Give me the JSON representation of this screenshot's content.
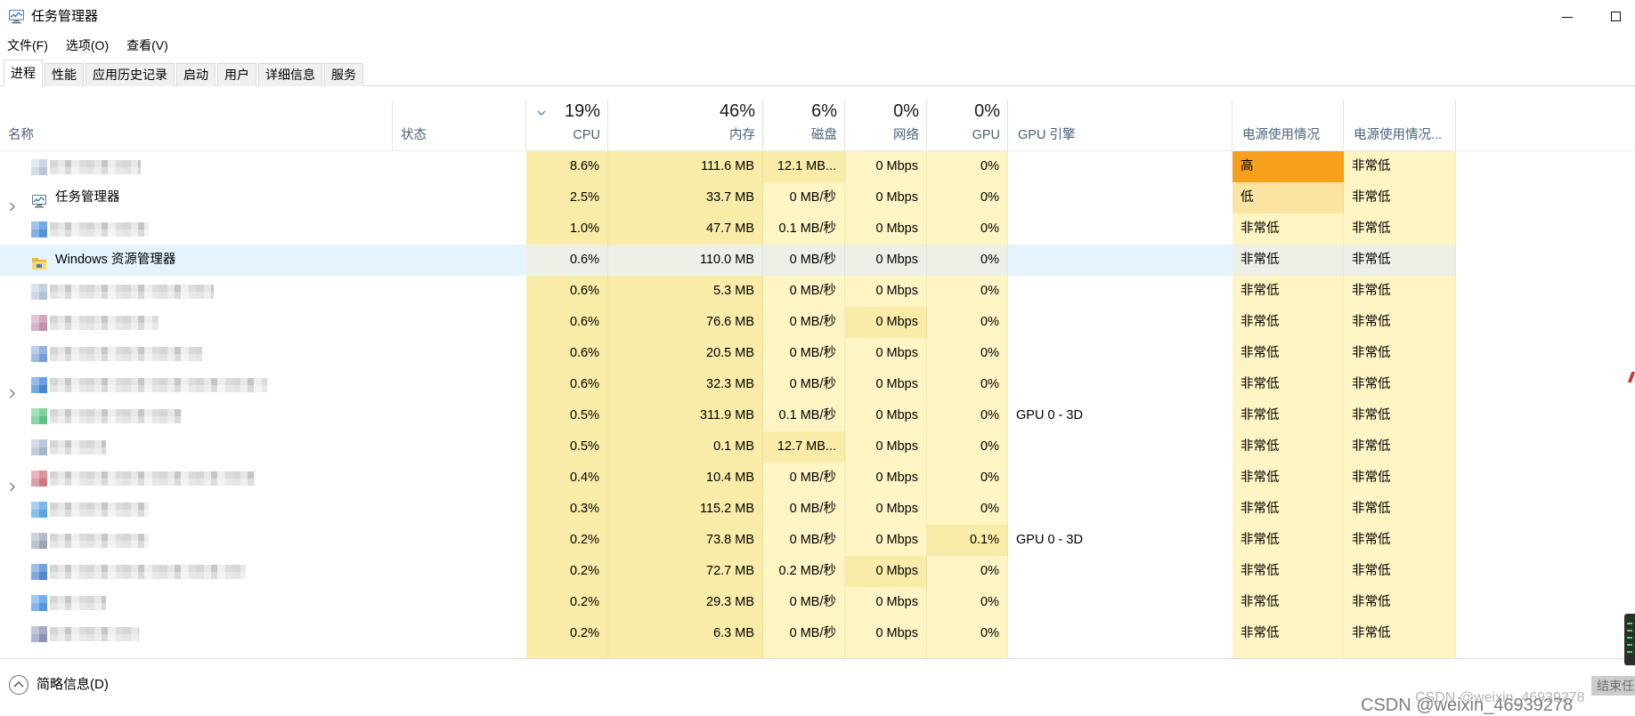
{
  "window": {
    "title": "任务管理器",
    "icon": "task-manager-icon",
    "controls": [
      "minimize-icon",
      "maximize-icon"
    ]
  },
  "menu": [
    {
      "label": "文件(F)"
    },
    {
      "label": "选项(O)"
    },
    {
      "label": "查看(V)"
    }
  ],
  "tabs": [
    {
      "label": "进程",
      "selected": true
    },
    {
      "label": "性能",
      "selected": false
    },
    {
      "label": "应用历史记录",
      "selected": false
    },
    {
      "label": "启动",
      "selected": false
    },
    {
      "label": "用户",
      "selected": false
    },
    {
      "label": "详细信息",
      "selected": false
    },
    {
      "label": "服务",
      "selected": false
    }
  ],
  "columns": {
    "name": {
      "label": "名称"
    },
    "status": {
      "label": "状态"
    },
    "cpu": {
      "label": "CPU",
      "usage": "19%",
      "sorted": true
    },
    "memory": {
      "label": "内存",
      "usage": "46%"
    },
    "disk": {
      "label": "磁盘",
      "usage": "6%"
    },
    "network": {
      "label": "网络",
      "usage": "0%"
    },
    "gpu": {
      "label": "GPU",
      "usage": "0%"
    },
    "gpu_engine": {
      "label": "GPU 引擎"
    },
    "power": {
      "label": "电源使用情况"
    },
    "power_trend": {
      "label": "电源使用情况..."
    }
  },
  "heat_palette": [
    "#FFF4C4",
    "#F9ECA8",
    "#FBE4A2",
    "#F9C75E",
    "#F8A01C"
  ],
  "default_heat": {
    "cpu": 1,
    "memory": 1,
    "disk": 0,
    "network": 0,
    "gpu": 0,
    "power": 0,
    "power_trend": 0
  },
  "selection_colors": {
    "plain_cell": "#E5F3FF",
    "heat_cell": "#EDF0E6"
  },
  "processes": [
    {
      "name": null,
      "icon": "app-icon",
      "icon_color": "#C7D3E3",
      "expandable": false,
      "selected": false,
      "cpu": "8.6%",
      "memory": "111.6 MB",
      "disk": "12.1 MB...",
      "network": "0 Mbps",
      "gpu": "0%",
      "gpu_engine": "",
      "power": "高",
      "power_trend": "非常低",
      "heat": {
        "disk": 1,
        "power": 4
      }
    },
    {
      "name": "任务管理器",
      "icon": "task-manager-icon",
      "expandable": true,
      "selected": false,
      "cpu": "2.5%",
      "memory": "33.7 MB",
      "disk": "0 MB/秒",
      "network": "0 Mbps",
      "gpu": "0%",
      "gpu_engine": "",
      "power": "低",
      "power_trend": "非常低",
      "heat": {
        "power": 2
      }
    },
    {
      "name": null,
      "icon": "app-icon",
      "icon_color": "#3C8EE8",
      "expandable": false,
      "selected": false,
      "cpu": "1.0%",
      "memory": "47.7 MB",
      "disk": "0.1 MB/秒",
      "network": "0 Mbps",
      "gpu": "0%",
      "gpu_engine": "",
      "power": "非常低",
      "power_trend": "非常低",
      "heat": {}
    },
    {
      "name": "Windows 资源管理器",
      "icon": "file-explorer-icon",
      "expandable": false,
      "selected": true,
      "cpu": "0.6%",
      "memory": "110.0 MB",
      "disk": "0 MB/秒",
      "network": "0 Mbps",
      "gpu": "0%",
      "gpu_engine": "",
      "power": "非常低",
      "power_trend": "非常低",
      "heat": {}
    },
    {
      "name": null,
      "icon": "app-icon",
      "icon_color": "#B8CCE4",
      "expandable": false,
      "selected": false,
      "cpu": "0.6%",
      "memory": "5.3 MB",
      "disk": "0 MB/秒",
      "network": "0 Mbps",
      "gpu": "0%",
      "gpu_engine": "",
      "power": "非常低",
      "power_trend": "非常低",
      "heat": {}
    },
    {
      "name": null,
      "icon": "app-icon",
      "icon_color": "#C98FB0",
      "expandable": false,
      "selected": false,
      "cpu": "0.6%",
      "memory": "76.6 MB",
      "disk": "0 MB/秒",
      "network": "0 Mbps",
      "gpu": "0%",
      "gpu_engine": "",
      "power": "非常低",
      "power_trend": "非常低",
      "heat": {
        "network": 1
      }
    },
    {
      "name": null,
      "icon": "app-icon",
      "icon_color": "#6E9FE2",
      "expandable": false,
      "selected": false,
      "cpu": "0.6%",
      "memory": "20.5 MB",
      "disk": "0 MB/秒",
      "network": "0 Mbps",
      "gpu": "0%",
      "gpu_engine": "",
      "power": "非常低",
      "power_trend": "非常低",
      "heat": {}
    },
    {
      "name": null,
      "icon": "app-icon",
      "icon_color": "#2F7FD9",
      "expandable": true,
      "selected": false,
      "cpu": "0.6%",
      "memory": "32.3 MB",
      "disk": "0 MB/秒",
      "network": "0 Mbps",
      "gpu": "0%",
      "gpu_engine": "",
      "power": "非常低",
      "power_trend": "非常低",
      "heat": {}
    },
    {
      "name": null,
      "icon": "app-icon",
      "icon_color": "#4CCB7D",
      "expandable": false,
      "selected": false,
      "cpu": "0.5%",
      "memory": "311.9 MB",
      "disk": "0.1 MB/秒",
      "network": "0 Mbps",
      "gpu": "0%",
      "gpu_engine": "GPU 0 - 3D",
      "power": "非常低",
      "power_trend": "非常低",
      "heat": {}
    },
    {
      "name": null,
      "icon": "app-icon",
      "icon_color": "#A9BDD6",
      "expandable": false,
      "selected": false,
      "cpu": "0.5%",
      "memory": "0.1 MB",
      "disk": "12.7 MB...",
      "network": "0 Mbps",
      "gpu": "0%",
      "gpu_engine": "",
      "power": "非常低",
      "power_trend": "非常低",
      "heat": {
        "disk": 1
      }
    },
    {
      "name": null,
      "icon": "app-icon",
      "icon_color": "#D9707E",
      "expandable": true,
      "selected": false,
      "cpu": "0.4%",
      "memory": "10.4 MB",
      "disk": "0 MB/秒",
      "network": "0 Mbps",
      "gpu": "0%",
      "gpu_engine": "",
      "power": "非常低",
      "power_trend": "非常低",
      "heat": {}
    },
    {
      "name": null,
      "icon": "app-icon",
      "icon_color": "#4BA4F1",
      "expandable": false,
      "selected": false,
      "cpu": "0.3%",
      "memory": "115.2 MB",
      "disk": "0 MB/秒",
      "network": "0 Mbps",
      "gpu": "0%",
      "gpu_engine": "",
      "power": "非常低",
      "power_trend": "非常低",
      "heat": {}
    },
    {
      "name": null,
      "icon": "app-icon",
      "icon_color": "#9DAABB",
      "expandable": false,
      "selected": false,
      "cpu": "0.2%",
      "memory": "73.8 MB",
      "disk": "0 MB/秒",
      "network": "0 Mbps",
      "gpu": "0.1%",
      "gpu_engine": "GPU 0 - 3D",
      "power": "非常低",
      "power_trend": "非常低",
      "heat": {
        "gpu": 1
      }
    },
    {
      "name": null,
      "icon": "app-icon",
      "icon_color": "#3C7FD9",
      "expandable": false,
      "selected": false,
      "cpu": "0.2%",
      "memory": "72.7 MB",
      "disk": "0.2 MB/秒",
      "network": "0 Mbps",
      "gpu": "0%",
      "gpu_engine": "",
      "power": "非常低",
      "power_trend": "非常低",
      "heat": {
        "network": 1
      }
    },
    {
      "name": null,
      "icon": "app-icon",
      "icon_color": "#3F94EF",
      "expandable": false,
      "selected": false,
      "cpu": "0.2%",
      "memory": "29.3 MB",
      "disk": "0 MB/秒",
      "network": "0 Mbps",
      "gpu": "0%",
      "gpu_engine": "",
      "power": "非常低",
      "power_trend": "非常低",
      "heat": {}
    },
    {
      "name": null,
      "icon": "app-icon",
      "icon_color": "#8B90B9",
      "expandable": false,
      "selected": false,
      "cpu": "0.2%",
      "memory": "6.3 MB",
      "disk": "0 MB/秒",
      "network": "0 Mbps",
      "gpu": "0%",
      "gpu_engine": "",
      "power": "非常低",
      "power_trend": "非常低",
      "heat": {}
    }
  ],
  "footer": {
    "fewer_details_label": "简略信息(D)",
    "fewer_details_icon": "chevron-up-circle-icon",
    "end_task_label": "结束任"
  },
  "watermark": "CSDN @weixin_46939278"
}
